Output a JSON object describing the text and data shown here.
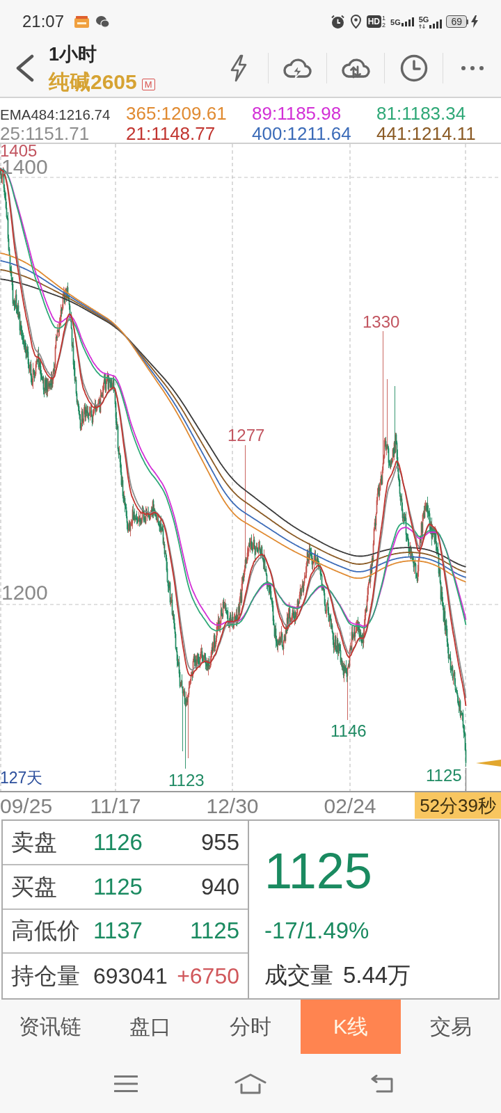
{
  "status_bar": {
    "time": "21:07",
    "hd": "HD",
    "sim_slots": [
      "1",
      "2"
    ],
    "networks": [
      {
        "label": "5G",
        "data_active": false
      },
      {
        "label": "5G",
        "data_active": true
      }
    ],
    "battery": "69",
    "charging": true
  },
  "header": {
    "period": "1小时",
    "symbol": "纯碱2605",
    "badge": "M"
  },
  "indicators": [
    {
      "label": "EMA484:1216.74",
      "color": "#3a3a3a"
    },
    {
      "label": "365:1209.61",
      "color": "#e08a30"
    },
    {
      "label": "89:1185.98",
      "color": "#d22fd6"
    },
    {
      "label": "81:1183.34",
      "color": "#2fa877"
    },
    {
      "label": "25:1151.71",
      "color": "#8c8c8c"
    },
    {
      "label": "21:1148.77",
      "color": "#c1342f"
    },
    {
      "label": "400:1211.64",
      "color": "#3b6bb8"
    },
    {
      "label": "441:1214.11",
      "color": "#8a5a24"
    }
  ],
  "chart": {
    "y_labels": [
      "1400",
      "1200"
    ],
    "price_marks": [
      {
        "text": "1405",
        "kind": "high"
      },
      {
        "text": "1330",
        "kind": "high"
      },
      {
        "text": "1277",
        "kind": "high"
      },
      {
        "text": "1146",
        "kind": "low"
      },
      {
        "text": "1123",
        "kind": "low"
      },
      {
        "text": "1125",
        "kind": "low"
      }
    ],
    "span": "127天",
    "dates": [
      "09/25",
      "11/17",
      "12/30",
      "02/24"
    ],
    "countdown": "52分39秒"
  },
  "quote": {
    "rows": [
      {
        "label": "卖盘",
        "values": [
          {
            "text": "1126",
            "color": "#1a8a60"
          },
          {
            "text": "955",
            "color": "#383838"
          }
        ]
      },
      {
        "label": "买盘",
        "values": [
          {
            "text": "1125",
            "color": "#1a8a60"
          },
          {
            "text": "940",
            "color": "#383838"
          }
        ]
      },
      {
        "label": "高低价",
        "values": [
          {
            "text": "1137",
            "color": "#1a8a60"
          },
          {
            "text": "1125",
            "color": "#1a8a60"
          }
        ]
      },
      {
        "label": "持仓量",
        "values": [
          {
            "text": "693041",
            "color": "#383838"
          },
          {
            "text": "+6750",
            "color": "#d0575b"
          }
        ]
      }
    ],
    "last": {
      "text": "1125",
      "color": "#1a8a60"
    },
    "change": {
      "text": "-17/1.49%",
      "color": "#1a8a60"
    },
    "turnover_label": "成交量",
    "turnover": "5.44万"
  },
  "tabs": [
    {
      "label": "资讯链",
      "selected": false
    },
    {
      "label": "盘口",
      "selected": false
    },
    {
      "label": "分时",
      "selected": false
    },
    {
      "label": "K线",
      "selected": true
    },
    {
      "label": "交易",
      "selected": false
    }
  ]
}
